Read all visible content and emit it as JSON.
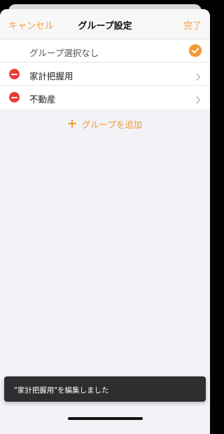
{
  "navbar": {
    "cancel_label": "キャンセル",
    "title": "グループ設定",
    "done_label": "完了"
  },
  "groups": {
    "none_option": {
      "label": "グループ選択なし",
      "selected": true
    },
    "items": [
      {
        "label": "家計把握用"
      },
      {
        "label": "不動産"
      }
    ]
  },
  "add_group": {
    "label": "グループを追加"
  },
  "toast": {
    "message": "\"家計把握用\"を編集しました"
  },
  "icons": {
    "check": "checkmark-icon",
    "delete": "minus-circle-icon",
    "chevron": "chevron-right-icon",
    "add": "plus-icon"
  },
  "colors": {
    "accent": "#f5a142",
    "delete": "#ec3a35",
    "toast_background": "#2e2e30",
    "background": "#f2f2f7"
  }
}
